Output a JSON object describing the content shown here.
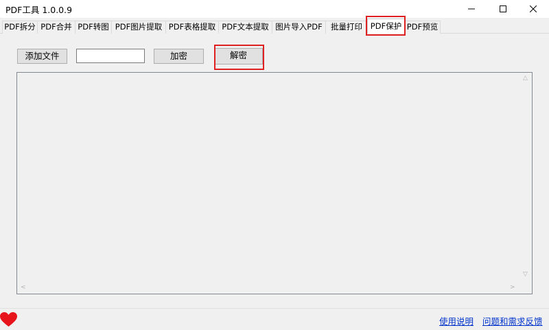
{
  "window": {
    "title": "PDF工具 1.0.0.9",
    "minimize_icon": "minimize-icon",
    "maximize_icon": "maximize-icon",
    "close_icon": "close-icon"
  },
  "tabs": [
    {
      "label": "PDF拆分"
    },
    {
      "label": "PDF合并"
    },
    {
      "label": "PDF转图"
    },
    {
      "label": "PDF图片提取"
    },
    {
      "label": "PDF表格提取"
    },
    {
      "label": "PDF文本提取"
    },
    {
      "label": "图片导入PDF"
    },
    {
      "label": "批量打印"
    },
    {
      "label": "PDF保护"
    },
    {
      "label": "PDF预览"
    }
  ],
  "active_tab": "PDF保护",
  "toolbar": {
    "add_file_label": "添加文件",
    "password_value": "",
    "encrypt_label": "加密",
    "decrypt_label": "解密"
  },
  "log": {
    "content": ""
  },
  "footer": {
    "heart_icon": "heart-icon",
    "heart_color": "#e8141c",
    "help_link": "使用说明",
    "feedback_link": "问题和需求反馈"
  },
  "colors": {
    "highlight": "#e02020",
    "link": "#0033cc"
  }
}
